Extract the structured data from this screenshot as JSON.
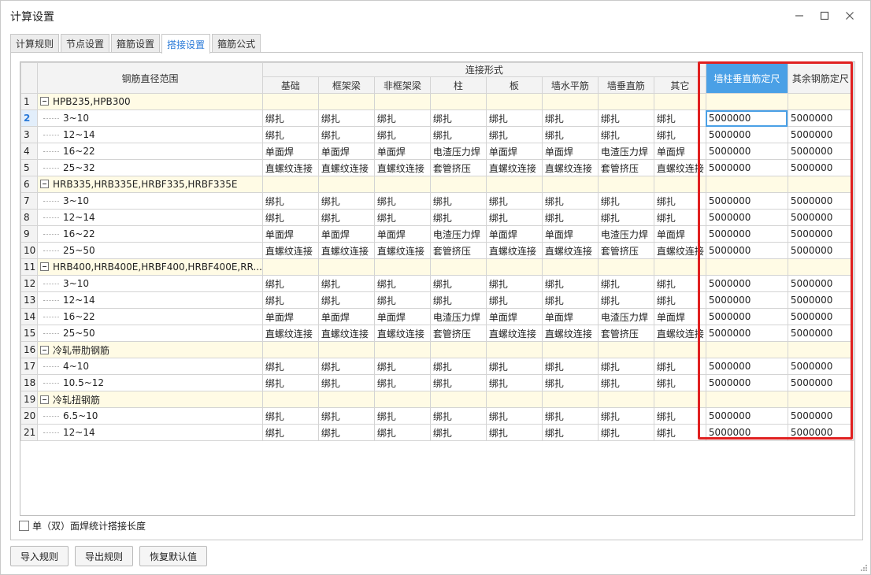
{
  "window": {
    "title": "计算设置"
  },
  "tabs": [
    "计算规则",
    "节点设置",
    "箍筋设置",
    "搭接设置",
    "箍筋公式"
  ],
  "active_tab": "搭接设置",
  "table": {
    "range_header": "钢筋直径范围",
    "group_header": "连接形式",
    "columns": [
      "基础",
      "框架梁",
      "非框架梁",
      "柱",
      "板",
      "墙水平筋",
      "墙垂直筋",
      "其它"
    ],
    "wall_col_header": "墙柱垂直筋定尺",
    "other_col_header": "其余钢筋定尺",
    "rows": [
      {
        "num": "1",
        "type": "group",
        "label": "HPB235,HPB300"
      },
      {
        "num": "2",
        "type": "item",
        "label": "3~10",
        "conn": [
          "绑扎",
          "绑扎",
          "绑扎",
          "绑扎",
          "绑扎",
          "绑扎",
          "绑扎",
          "绑扎"
        ],
        "wall": "5000000",
        "other": "5000000"
      },
      {
        "num": "3",
        "type": "item",
        "label": "12~14",
        "conn": [
          "绑扎",
          "绑扎",
          "绑扎",
          "绑扎",
          "绑扎",
          "绑扎",
          "绑扎",
          "绑扎"
        ],
        "wall": "5000000",
        "other": "5000000"
      },
      {
        "num": "4",
        "type": "item",
        "label": "16~22",
        "conn": [
          "单面焊",
          "单面焊",
          "单面焊",
          "电渣压力焊",
          "单面焊",
          "单面焊",
          "电渣压力焊",
          "单面焊"
        ],
        "wall": "5000000",
        "other": "5000000"
      },
      {
        "num": "5",
        "type": "item",
        "label": "25~32",
        "conn": [
          "直螺纹连接",
          "直螺纹连接",
          "直螺纹连接",
          "套管挤压",
          "直螺纹连接",
          "直螺纹连接",
          "套管挤压",
          "直螺纹连接"
        ],
        "wall": "5000000",
        "other": "5000000"
      },
      {
        "num": "6",
        "type": "group",
        "label": "HRB335,HRB335E,HRBF335,HRBF335E"
      },
      {
        "num": "7",
        "type": "item",
        "label": "3~10",
        "conn": [
          "绑扎",
          "绑扎",
          "绑扎",
          "绑扎",
          "绑扎",
          "绑扎",
          "绑扎",
          "绑扎"
        ],
        "wall": "5000000",
        "other": "5000000"
      },
      {
        "num": "8",
        "type": "item",
        "label": "12~14",
        "conn": [
          "绑扎",
          "绑扎",
          "绑扎",
          "绑扎",
          "绑扎",
          "绑扎",
          "绑扎",
          "绑扎"
        ],
        "wall": "5000000",
        "other": "5000000"
      },
      {
        "num": "9",
        "type": "item",
        "label": "16~22",
        "conn": [
          "单面焊",
          "单面焊",
          "单面焊",
          "电渣压力焊",
          "单面焊",
          "单面焊",
          "电渣压力焊",
          "单面焊"
        ],
        "wall": "5000000",
        "other": "5000000"
      },
      {
        "num": "10",
        "type": "item",
        "label": "25~50",
        "conn": [
          "直螺纹连接",
          "直螺纹连接",
          "直螺纹连接",
          "套管挤压",
          "直螺纹连接",
          "直螺纹连接",
          "套管挤压",
          "直螺纹连接"
        ],
        "wall": "5000000",
        "other": "5000000"
      },
      {
        "num": "11",
        "type": "group",
        "label": "HRB400,HRB400E,HRBF400,HRBF400E,RR..."
      },
      {
        "num": "12",
        "type": "item",
        "label": "3~10",
        "conn": [
          "绑扎",
          "绑扎",
          "绑扎",
          "绑扎",
          "绑扎",
          "绑扎",
          "绑扎",
          "绑扎"
        ],
        "wall": "5000000",
        "other": "5000000"
      },
      {
        "num": "13",
        "type": "item",
        "label": "12~14",
        "conn": [
          "绑扎",
          "绑扎",
          "绑扎",
          "绑扎",
          "绑扎",
          "绑扎",
          "绑扎",
          "绑扎"
        ],
        "wall": "5000000",
        "other": "5000000"
      },
      {
        "num": "14",
        "type": "item",
        "label": "16~22",
        "conn": [
          "单面焊",
          "单面焊",
          "单面焊",
          "电渣压力焊",
          "单面焊",
          "单面焊",
          "电渣压力焊",
          "单面焊"
        ],
        "wall": "5000000",
        "other": "5000000"
      },
      {
        "num": "15",
        "type": "item",
        "label": "25~50",
        "conn": [
          "直螺纹连接",
          "直螺纹连接",
          "直螺纹连接",
          "套管挤压",
          "直螺纹连接",
          "直螺纹连接",
          "套管挤压",
          "直螺纹连接"
        ],
        "wall": "5000000",
        "other": "5000000"
      },
      {
        "num": "16",
        "type": "group",
        "label": "冷轧带肋钢筋"
      },
      {
        "num": "17",
        "type": "item",
        "label": "4~10",
        "conn": [
          "绑扎",
          "绑扎",
          "绑扎",
          "绑扎",
          "绑扎",
          "绑扎",
          "绑扎",
          "绑扎"
        ],
        "wall": "5000000",
        "other": "5000000"
      },
      {
        "num": "18",
        "type": "item",
        "label": "10.5~12",
        "conn": [
          "绑扎",
          "绑扎",
          "绑扎",
          "绑扎",
          "绑扎",
          "绑扎",
          "绑扎",
          "绑扎"
        ],
        "wall": "5000000",
        "other": "5000000"
      },
      {
        "num": "19",
        "type": "group",
        "label": "冷轧扭钢筋"
      },
      {
        "num": "20",
        "type": "item",
        "label": "6.5~10",
        "conn": [
          "绑扎",
          "绑扎",
          "绑扎",
          "绑扎",
          "绑扎",
          "绑扎",
          "绑扎",
          "绑扎"
        ],
        "wall": "5000000",
        "other": "5000000"
      },
      {
        "num": "21",
        "type": "item",
        "label": "12~14",
        "conn": [
          "绑扎",
          "绑扎",
          "绑扎",
          "绑扎",
          "绑扎",
          "绑扎",
          "绑扎",
          "绑扎"
        ],
        "wall": "5000000",
        "other": "5000000"
      }
    ]
  },
  "checkbox_label": "单（双）面焊统计搭接长度",
  "buttons": {
    "import": "导入规则",
    "export": "导出规则",
    "restore": "恢复默认值"
  },
  "colors": {
    "accent": "#4aa0e6",
    "highlight_box": "#e02020",
    "group_row_bg": "#fffbe5"
  }
}
